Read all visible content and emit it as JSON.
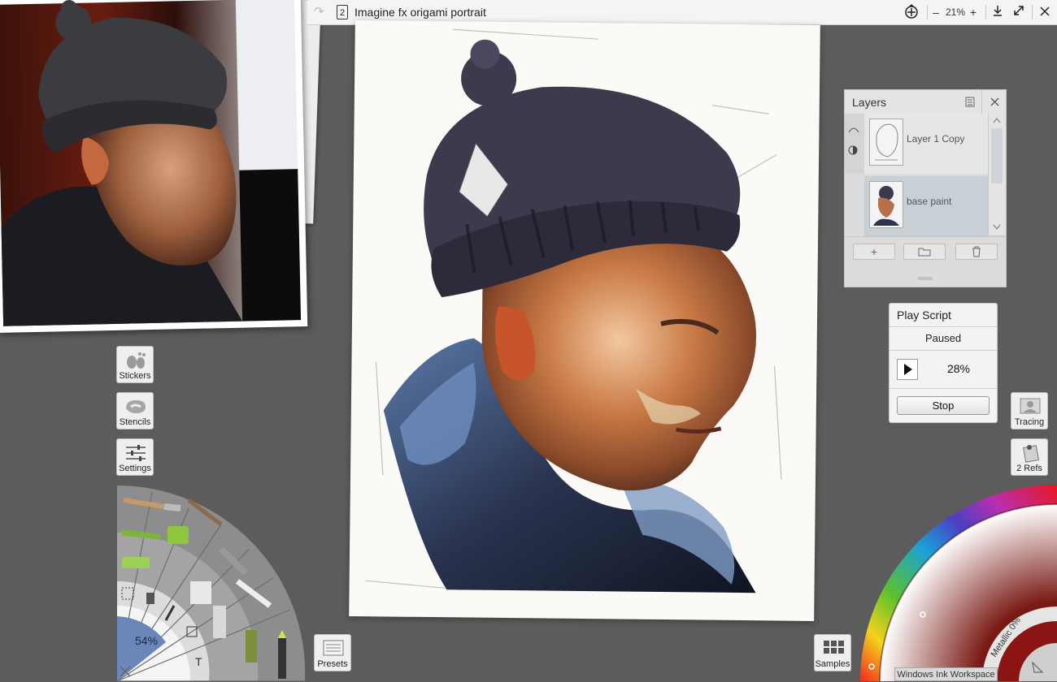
{
  "document": {
    "title": "Imagine fx origami portrait",
    "page_indicator": "2",
    "zoom_label": "21%",
    "zoom_minus": "–",
    "zoom_plus": "+"
  },
  "left_tools": {
    "stickers_label": "Stickers",
    "stencils_label": "Stencils",
    "settings_label": "Settings",
    "presets_label": "Presets"
  },
  "tool_wheel": {
    "size_value": "54%",
    "text_tool_glyph": "T"
  },
  "layers_panel": {
    "title": "Layers",
    "layers": [
      {
        "name": "Layer 1 Copy"
      },
      {
        "name": "base paint"
      }
    ],
    "add_glyph": "+"
  },
  "play_script": {
    "title": "Play Script",
    "status": "Paused",
    "progress": "28%",
    "stop_label": "Stop"
  },
  "right_tools": {
    "tracing_label": "Tracing",
    "refs_label": "2 Refs",
    "samples_label": "Samples"
  },
  "color_picker": {
    "metallic_label": "Metallic 0%"
  },
  "system": {
    "ink_workspace": "Windows Ink Workspace"
  }
}
